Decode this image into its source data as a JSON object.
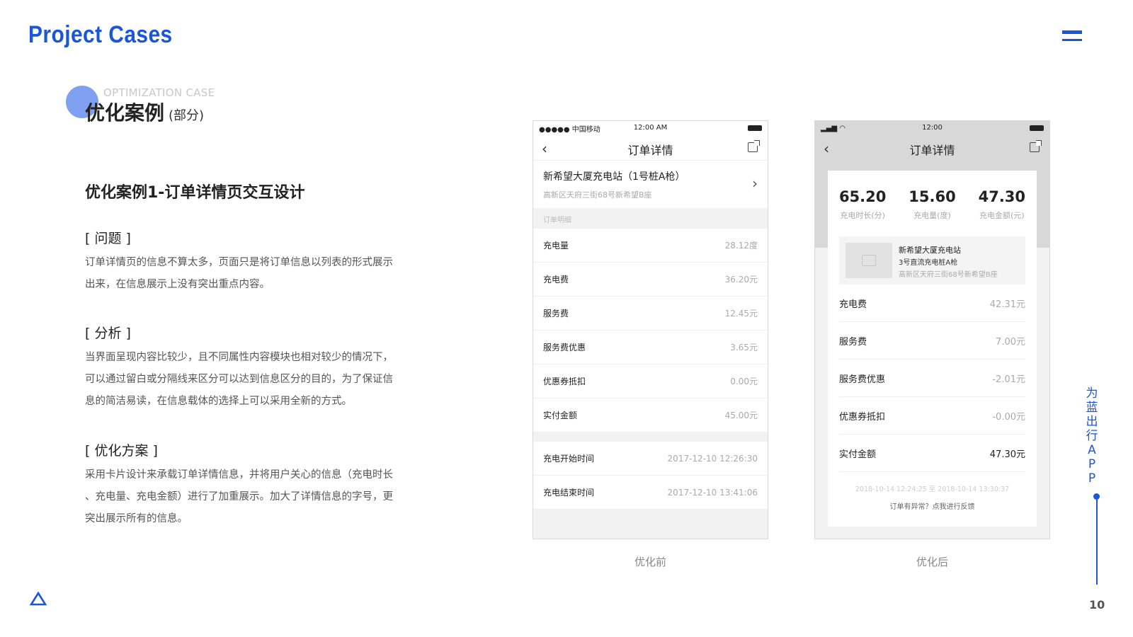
{
  "header": {
    "brand": "Project Cases",
    "menu_icon": "menu-icon"
  },
  "section": {
    "en": "OPTIMIZATION CASE",
    "title": "优化案例",
    "sub": "(部分)"
  },
  "case": {
    "title": "优化案例1-订单详情页交互设计",
    "blocks": [
      {
        "head": "[ 问题 ]",
        "lines": [
          "订单详情页的信息不算太多，页面只是将订单信息以列表的形式展示",
          "出来，在信息展示上没有突出重点内容。"
        ]
      },
      {
        "head": "[ 分析 ]",
        "lines": [
          "当界面呈现内容比较少，且不同属性内容模块也相对较少的情况下，",
          "可以通过留白或分隔线来区分可以达到信息区分的目的，为了保证信",
          "息的简洁易读，在信息载体的选择上可以采用全新的方式。"
        ]
      },
      {
        "head": "[ 优化方案 ]",
        "lines": [
          "采用卡片设计来承载订单详情信息，并将用户关心的信息（充电时长",
          "、充电量、充电金额）进行了加重展示。加大了详情信息的字号，更",
          "突出展示所有的信息。"
        ]
      }
    ]
  },
  "before": {
    "status_left": "●●●●● 中国移动",
    "status_time": "12:00 AM",
    "nav_title": "订单详情",
    "station_name": "新希望大厦充电站（1号桩A枪）",
    "station_addr": "高新区天府三街68号新希望B座",
    "group_label": "订单明细",
    "rows": [
      {
        "k": "充电量",
        "v": "28.12度"
      },
      {
        "k": "充电费",
        "v": "36.20元"
      },
      {
        "k": "服务费",
        "v": "12.45元"
      },
      {
        "k": "服务费优惠",
        "v": "3.65元"
      },
      {
        "k": "优惠券抵扣",
        "v": "0.00元"
      },
      {
        "k": "实付金额",
        "v": "45.00元"
      }
    ],
    "time_rows": [
      {
        "k": "充电开始时间",
        "v": "2017-12-10 12:26:30"
      },
      {
        "k": "充电结束时间",
        "v": "2017-12-10 13:41:06"
      }
    ],
    "caption": "优化前"
  },
  "after": {
    "status_left": "",
    "status_time": "12:00",
    "nav_title": "订单详情",
    "stats": [
      {
        "num": "65.20",
        "lbl": "充电时长(分)"
      },
      {
        "num": "15.60",
        "lbl": "充电量(度)"
      },
      {
        "num": "47.30",
        "lbl": "充电金额(元)"
      }
    ],
    "station_name": "新希望大厦充电站",
    "station_pile": "3号直流充电桩A枪",
    "station_addr": "高新区天府三街68号新希望B座",
    "rows": [
      {
        "k": "充电费",
        "v": "42.31元"
      },
      {
        "k": "服务费",
        "v": "7.00元"
      },
      {
        "k": "服务费优惠",
        "v": "-2.01元"
      },
      {
        "k": "优惠券抵扣",
        "v": "-0.00元"
      },
      {
        "k": "实付金额",
        "v": "47.30元"
      }
    ],
    "time_range": "2018-10-14 12:24:25 至 2018-10-14 13:30:37",
    "feedback": "订单有异常？点我进行反馈",
    "caption": "优化后"
  },
  "side": {
    "text": "为蓝出行APP",
    "page": "10"
  },
  "colors": {
    "brand": "#1a56d8",
    "accent_circle": "#7f9ff0"
  }
}
